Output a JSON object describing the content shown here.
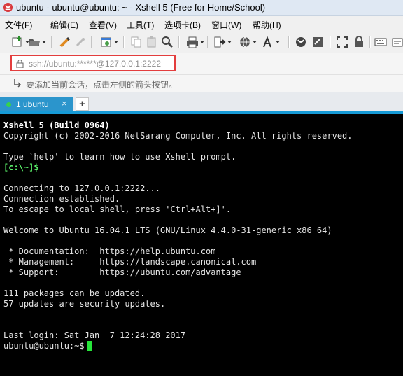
{
  "window": {
    "title": "ubuntu - ubuntu@ubuntu: ~ - Xshell 5 (Free for Home/School)"
  },
  "menu": [
    {
      "label": "文件(F)",
      "name": "menu-file"
    },
    {
      "label": "编辑(E)",
      "name": "menu-edit"
    },
    {
      "label": "查看(V)",
      "name": "menu-view"
    },
    {
      "label": "工具(T)",
      "name": "menu-tools"
    },
    {
      "label": "选项卡(B)",
      "name": "menu-tabs"
    },
    {
      "label": "窗口(W)",
      "name": "menu-window"
    },
    {
      "label": "帮助(H)",
      "name": "menu-help"
    }
  ],
  "toolbar": {
    "icons": [
      "new-session-icon",
      "open-folder-icon",
      "disconnect-icon",
      "reconnect-icon",
      "properties-icon",
      "copy-icon",
      "paste-icon",
      "find-icon",
      "print-icon",
      "transfer-icon",
      "globe-icon",
      "font-icon",
      "xftp-icon",
      "script-icon",
      "fullscreen-icon",
      "lock-screen-icon",
      "keyboard-icon",
      "compose-icon"
    ]
  },
  "address": {
    "value": "ssh://ubuntu:******@127.0.0.1:2222",
    "highlight_color": "#e33d3d"
  },
  "hint": {
    "text": "要添加当前会话，点击左侧的箭头按钮。"
  },
  "tabs": [
    {
      "label": "1 ubuntu",
      "status_color": "#37d24b",
      "active": true
    }
  ],
  "tab_add_label": "+",
  "tab_close_label": "×",
  "terminal": {
    "lines": [
      "Xshell 5 (Build 0964)",
      "Copyright (c) 2002-2016 NetSarang Computer, Inc. All rights reserved.",
      "",
      "Type `help' to learn how to use Xshell prompt.",
      "[c:\\~]$",
      "",
      "Connecting to 127.0.0.1:2222...",
      "Connection established.",
      "To escape to local shell, press 'Ctrl+Alt+]'.",
      "",
      "Welcome to Ubuntu 16.04.1 LTS (GNU/Linux 4.4.0-31-generic x86_64)",
      "",
      " * Documentation:  https://help.ubuntu.com",
      " * Management:     https://landscape.canonical.com",
      " * Support:        https://ubuntu.com/advantage",
      "",
      "111 packages can be updated.",
      "57 updates are security updates.",
      "",
      "",
      "Last login: Sat Jan  7 12:24:28 2017",
      "ubuntu@ubuntu:~$ "
    ],
    "cursor_color": "#26e63a"
  }
}
